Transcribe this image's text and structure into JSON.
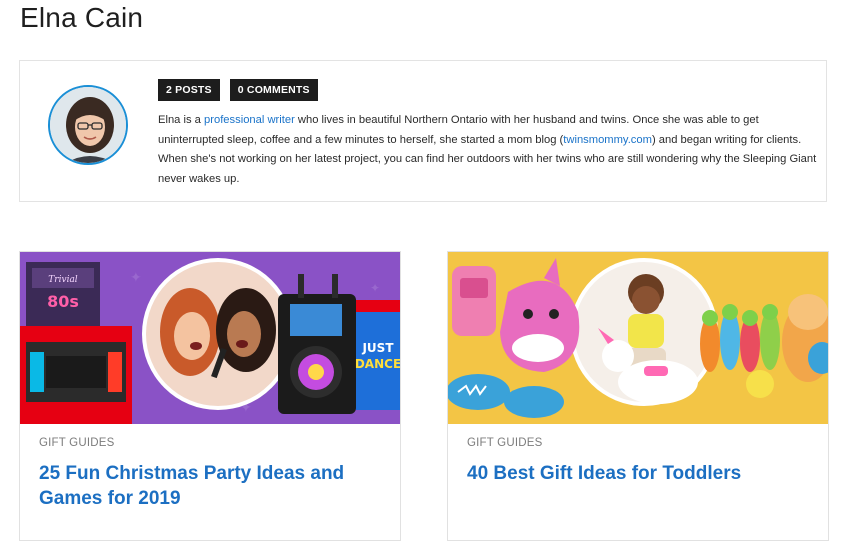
{
  "author": {
    "name": "Elna Cain",
    "posts_badge": "2 POSTS",
    "comments_badge": "0 COMMENTS",
    "bio": {
      "part1": "Elna is a ",
      "link1": "professional writer",
      "part2": " who lives in beautiful Northern Ontario with her husband and twins. Once she was able to get uninterrupted sleep, coffee and a few minutes to herself, she started a mom blog (",
      "link2": "twinsmommy.com",
      "part3": ") and began writing for clients. When she's not working on her latest project, you can find her outdoors with her twins who are still wondering why the Sleeping Giant never wakes up."
    }
  },
  "articles": [
    {
      "category": "GIFT GUIDES",
      "title": "25 Fun Christmas Party Ideas and Games for 2019"
    },
    {
      "category": "GIFT GUIDES",
      "title": "40 Best Gift Ideas for Toddlers"
    }
  ],
  "colors": {
    "link": "#1a73c9",
    "title_blue": "#1c6fc2",
    "badge_bg": "#1d1d1d",
    "card1_bg": "#8a52c6",
    "card2_bg": "#f3c545",
    "avatar_ring": "#1a8fd6"
  }
}
